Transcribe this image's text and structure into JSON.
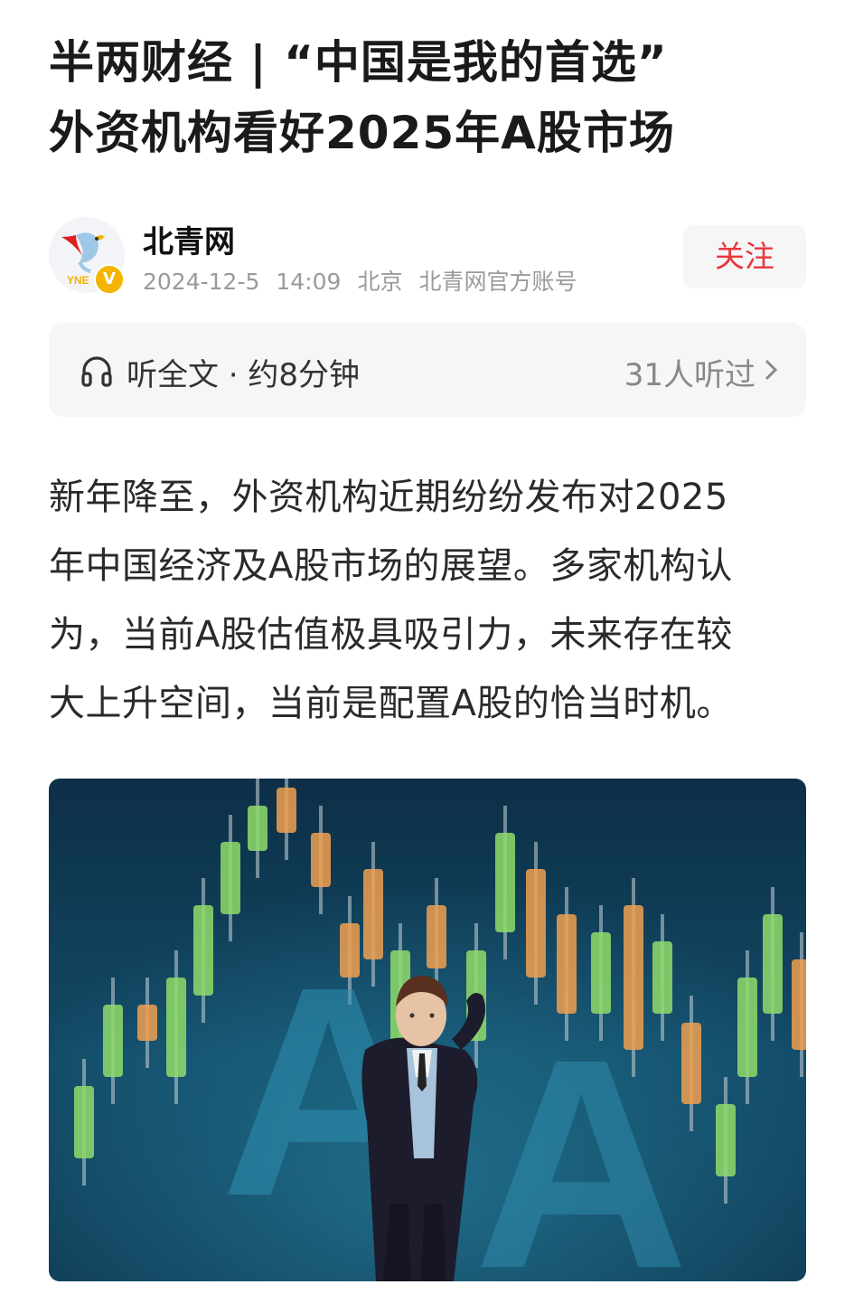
{
  "article": {
    "title_lines": [
      "半两财经 | “中国是我的首选”",
      "外资机构看好2025年A股市场"
    ],
    "author": {
      "name": "北青网",
      "avatar_text": "YNE",
      "verified_badge": "V",
      "date": "2024-12-5",
      "time": "14:09",
      "location": "北京",
      "account_type": "北青网官方账号"
    },
    "follow_label": "关注",
    "listen": {
      "icon": "headphones-icon",
      "label": "听全文 · 约8分钟",
      "count": "31人听过"
    },
    "body_lines": [
      "新年降至，外资机构近期纷纷发布对2025",
      "年中国经济及A股市场的展望。多家机构认",
      "为，当前A股估值极具吸引力，未来存在较",
      "大上升空间，当前是配置A股的恰当时机。"
    ],
    "hero_image": {
      "description_icon": "stock-candlestick-figurine-image",
      "big_letters": [
        "A",
        "A"
      ]
    }
  },
  "colors": {
    "follow_text": "#e8363d",
    "badge": "#f5b400",
    "candle_green": "#8fdc6a",
    "candle_orange": "#f0a050",
    "hero_bg": "#103650"
  }
}
